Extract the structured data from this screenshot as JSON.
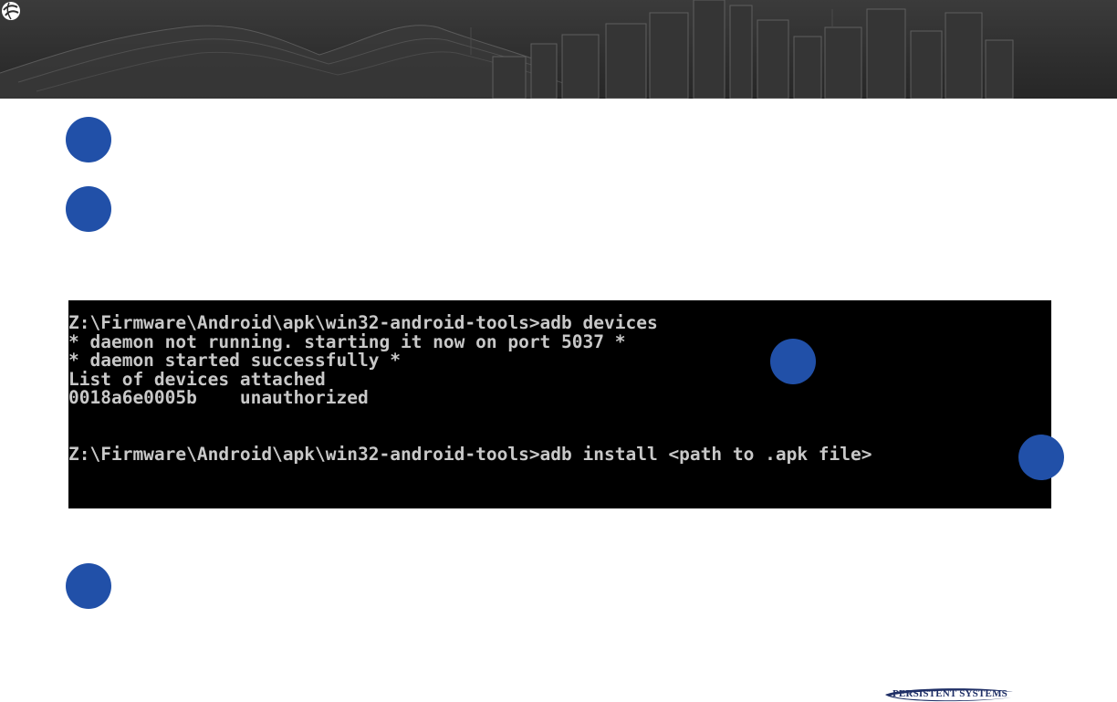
{
  "slide": {
    "footer_logo_text": "PERSISTENT SYSTEMS",
    "colors": {
      "banner_dark": "#2e2e2e",
      "step_marker_blue": "#2150a8",
      "terminal_bg": "#000000",
      "terminal_text": "#c8c8c8",
      "logo_blue": "#1f2f66"
    }
  },
  "terminal": {
    "lines": [
      "Z:\\Firmware\\Android\\apk\\win32-android-tools>adb devices",
      "* daemon not running. starting it now on port 5037 *",
      "* daemon started successfully *",
      "List of devices attached",
      "0018a6e0005b    unauthorized",
      "",
      "",
      "Z:\\Firmware\\Android\\apk\\win32-android-tools>adb install <path to .apk file>"
    ]
  },
  "icons": {
    "corner_logo": "persistent-logo-icon",
    "step_markers": [
      "step-marker-1",
      "step-marker-2",
      "step-marker-3",
      "step-marker-4",
      "step-marker-5"
    ]
  }
}
